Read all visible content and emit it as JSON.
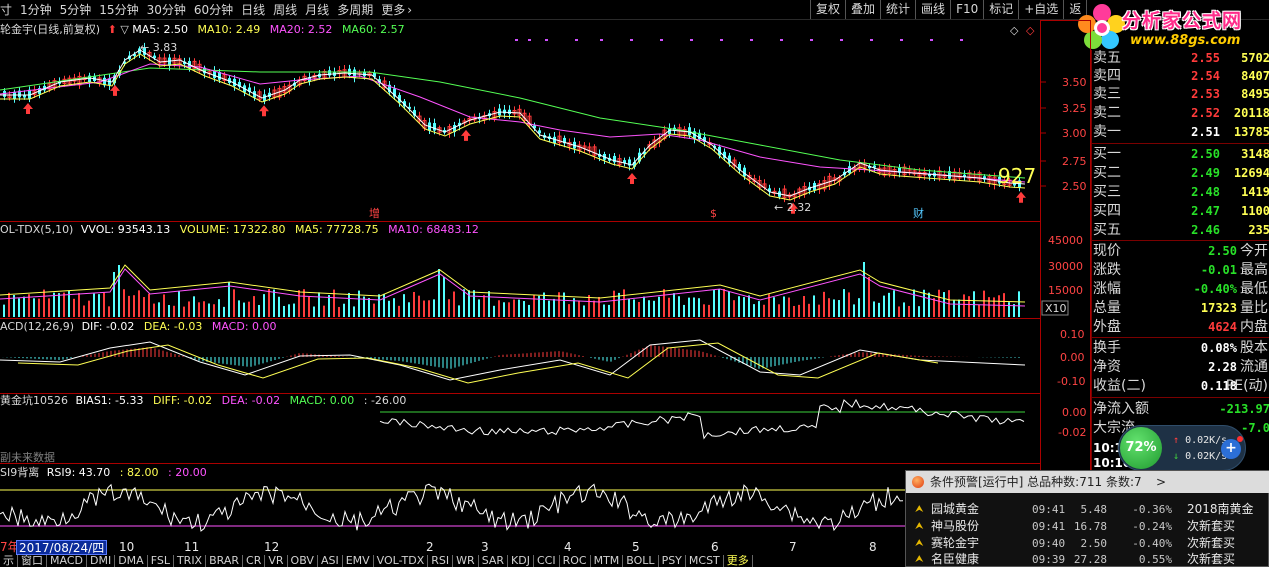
{
  "toolbar": {
    "periods": [
      "寸",
      "1分钟",
      "5分钟",
      "15分钟",
      "30分钟",
      "60分钟",
      "日线",
      "周线",
      "月线",
      "多周期",
      "更多"
    ],
    "tools": [
      "复权",
      "叠加",
      "统计",
      "画线",
      "F10",
      "标记",
      "+自选",
      "返"
    ]
  },
  "logo": {
    "title": "分析家公式网",
    "url": "www.88gs.com"
  },
  "main_chart": {
    "legend_name": "轮金宇(日线,前复权)",
    "ma5": "MA5: 2.50",
    "ma10": "MA10: 2.49",
    "ma20": "MA20: 2.52",
    "ma60": "MA60: 2.57",
    "high_label": "3.83",
    "low_label": "2.32",
    "big_number": "927",
    "markers": [
      "增",
      "$",
      "财"
    ],
    "y_ticks": [
      "3.50",
      "3.25",
      "3.00",
      "2.75",
      "2.50"
    ]
  },
  "vol_panel": {
    "legend_name": "OL-TDX(5,10)",
    "vvol": "VVOL: 93543.13",
    "volume": "VOLUME: 17322.80",
    "ma5": "MA5: 77728.75",
    "ma10": "MA10: 68483.12",
    "y_ticks": [
      "45000",
      "30000",
      "15000"
    ],
    "unit": "X10"
  },
  "macd_panel": {
    "legend_name": "ACD(12,26,9)",
    "dif": "DIF: -0.02",
    "dea": "DEA: -0.03",
    "macd": "MACD: 0.00",
    "y_ticks": [
      "0.10",
      "0.00",
      "-0.10"
    ]
  },
  "bias_panel": {
    "legend_name": "黄金坑10526",
    "bias1": "BIAS1: -5.33",
    "diff": "DIFF: -0.02",
    "dea": "DEA: -0.02",
    "macd": "MACD: 0.00",
    "extra": ": -26.00",
    "note": "副未来数据",
    "y_ticks": [
      "0.00",
      "-0.02"
    ]
  },
  "rsi_panel": {
    "legend_name": "SI9背离",
    "rsi9": "RSI9: 43.70",
    "v1": ": 82.00",
    "v2": ": 20.00"
  },
  "order_book": {
    "asks": [
      {
        "label": "卖五",
        "price": "2.55",
        "vol": "5702"
      },
      {
        "label": "卖四",
        "price": "2.54",
        "vol": "8407"
      },
      {
        "label": "卖三",
        "price": "2.53",
        "vol": "8495"
      },
      {
        "label": "卖二",
        "price": "2.52",
        "vol": "20118"
      },
      {
        "label": "卖一",
        "price": "2.51",
        "vol": "13785"
      }
    ],
    "bids": [
      {
        "label": "买一",
        "price": "2.50",
        "vol": "3148"
      },
      {
        "label": "买二",
        "price": "2.49",
        "vol": "12694"
      },
      {
        "label": "买三",
        "price": "2.48",
        "vol": "1419"
      },
      {
        "label": "买四",
        "price": "2.47",
        "vol": "1100"
      },
      {
        "label": "买五",
        "price": "2.46",
        "vol": "235"
      }
    ],
    "ask_color": "#ff3b3b",
    "bid_color": "#28e028",
    "price_color": "#ffffff"
  },
  "stats": [
    {
      "label": "现价",
      "value": "2.50",
      "right": "今开",
      "color": "#28e028"
    },
    {
      "label": "涨跌",
      "value": "-0.01",
      "right": "最高",
      "color": "#28e028"
    },
    {
      "label": "涨幅",
      "value": "-0.40%",
      "right": "最低",
      "color": "#28e028"
    },
    {
      "label": "总量",
      "value": "17323",
      "right": "量比",
      "color": "#ffff54"
    },
    {
      "label": "外盘",
      "value": "4624",
      "right": "内盘",
      "color": "#ff3b3b"
    },
    {
      "label": "换手",
      "value": "0.08%",
      "right": "股本",
      "color": "#ffffff"
    },
    {
      "label": "净资",
      "value": "2.28",
      "right": "流通",
      "color": "#ffffff"
    },
    {
      "label": "收益(二)",
      "value": "0.118",
      "right": "PE(动)",
      "color": "#ffffff"
    },
    {
      "label": "净流入额",
      "value": "-213.97",
      "right": "",
      "color": "#28e028"
    },
    {
      "label": "大宗流",
      "value": "-7.0",
      "right": "",
      "color": "#28e028"
    },
    {
      "label": "10:10",
      "value": "",
      "right": "",
      "color": "#ffffff"
    },
    {
      "label": "10:10",
      "value": "",
      "right": "",
      "color": "#ffffff"
    }
  ],
  "gauge": {
    "percent": "72%",
    "up": "0.02K/s",
    "down": "0.02K/s"
  },
  "alert": {
    "title": "条件预警[运行中] 总品种数:711 条数:7",
    "caret": ">",
    "rows": [
      {
        "name": "园城黄金",
        "time": "09:41",
        "price": "5.48",
        "chg": "-0.36%",
        "type": "2018南黄金"
      },
      {
        "name": "神马股份",
        "time": "09:41",
        "price": "16.78",
        "chg": "-0.24%",
        "type": "次新套买"
      },
      {
        "name": "赛轮金宇",
        "time": "09:40",
        "price": "2.50",
        "chg": "-0.40%",
        "type": "次新套买"
      },
      {
        "name": "名臣健康",
        "time": "09:39",
        "price": "27.28",
        "chg": "0.55%",
        "type": "次新套买"
      }
    ]
  },
  "date_bar": {
    "left_label": "7年",
    "current_date": "2017/08/24/四",
    "months": [
      "10",
      "11",
      "12",
      "2",
      "3",
      "4",
      "5",
      "6",
      "7",
      "8"
    ]
  },
  "indicator_tabs": [
    "示",
    "窗口",
    "MACD",
    "DMI",
    "DMA",
    "FSL",
    "TRIX",
    "BRAR",
    "CR",
    "VR",
    "OBV",
    "ASI",
    "EMV",
    "VOL-TDX",
    "RSI",
    "WR",
    "SAR",
    "KDJ",
    "CCI",
    "ROC",
    "MTM",
    "BOLL",
    "PSY",
    "MCST",
    "更多"
  ],
  "colors": {
    "up": "#ff3b3b",
    "down": "#54ffff",
    "ma5": "#ffffff",
    "ma10": "#ffff54",
    "ma20": "#ff54ff",
    "ma60": "#54ff54",
    "axis": "#aa0000"
  }
}
